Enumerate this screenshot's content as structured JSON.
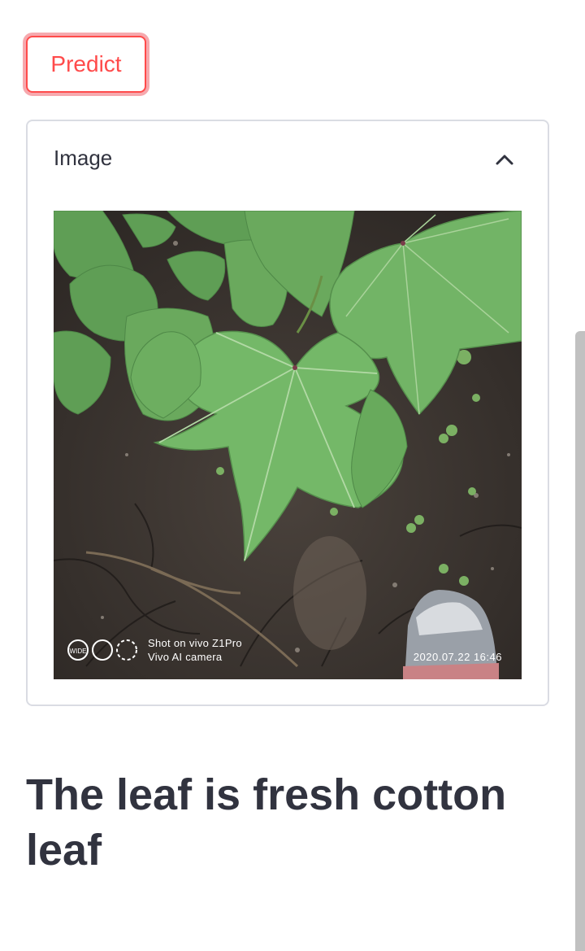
{
  "predict_button": {
    "label": "Predict"
  },
  "expander": {
    "title": "Image",
    "expanded": true,
    "image": {
      "watermark_line1": "Shot on vivo Z1Pro",
      "watermark_line2": "Vivo AI camera",
      "watermark_date": "2020.07.22 16:46",
      "mode_label": "WIDE"
    }
  },
  "result": {
    "text": "The leaf is fresh cotton leaf"
  },
  "colors": {
    "accent": "#ff4b4b",
    "text": "#31333f",
    "border": "#dadce3",
    "leaf": "#6fae62",
    "soil": "#3a332e"
  },
  "icons": {
    "expander_toggle": "chevron-up-icon",
    "mode": "wide-lens-icon"
  }
}
